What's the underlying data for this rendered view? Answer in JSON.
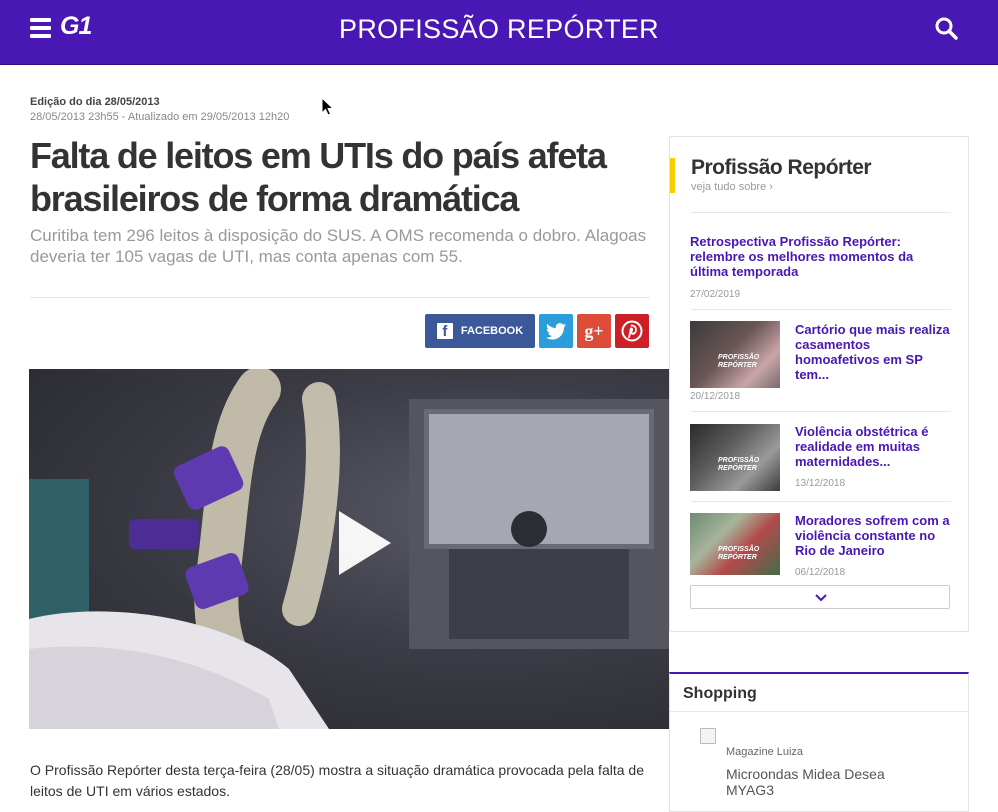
{
  "header": {
    "brand": "G1",
    "program_title": "PROFISSÃO REPÓRTER"
  },
  "article": {
    "edition": "Edição do dia 28/05/2013",
    "dates": "28/05/2013 23h55 - Atualizado em 29/05/2013 12h20",
    "headline": "Falta de leitos em UTIs do país afeta brasileiros de forma dramática",
    "subtitle": "Curitiba tem 296 leitos à disposição do SUS. A OMS recomenda o dobro. Alagoas deveria ter 105 vagas de UTI, mas conta apenas com 55.",
    "body": "O Profissão Repórter desta terça-feira (28/05) mostra a situação dramática provocada pela falta de leitos de UTI em vários estados."
  },
  "share": {
    "facebook_label": "FACEBOOK",
    "googleplus_label": "g+"
  },
  "sidebar": {
    "title": "Profissão Repórter",
    "see_all": "veja tudo sobre ›",
    "featured": {
      "title": "Retrospectiva Profissão Repórter: relembre os melhores momentos da última temporada",
      "date": "27/02/2019"
    },
    "items": [
      {
        "title": "Cartório que mais realiza casamentos homoafetivos em SP tem...",
        "date": "20/12/2018"
      },
      {
        "title": "Violência obstétrica é realidade em muitas maternidades...",
        "date": "13/12/2018"
      },
      {
        "title": "Moradores sofrem com a violência constante no Rio de Janeiro",
        "date": "06/12/2018"
      }
    ],
    "thumb_badge": "PROFISSÃO\nREPÓRTER"
  },
  "shopping": {
    "title": "Shopping",
    "store": "Magazine Luiza",
    "product": "Microondas Midea Desea MYAG3"
  },
  "colors": {
    "brand_purple": "#4817b4",
    "accent_yellow": "#f6cf00",
    "facebook": "#3b5998",
    "twitter": "#2b9ddb",
    "googleplus": "#dd4b39",
    "pinterest": "#cb2027"
  },
  "icons": {
    "menu": "hamburger-icon",
    "search": "search-icon",
    "play": "play-icon",
    "more": "chevron-down-icon"
  }
}
